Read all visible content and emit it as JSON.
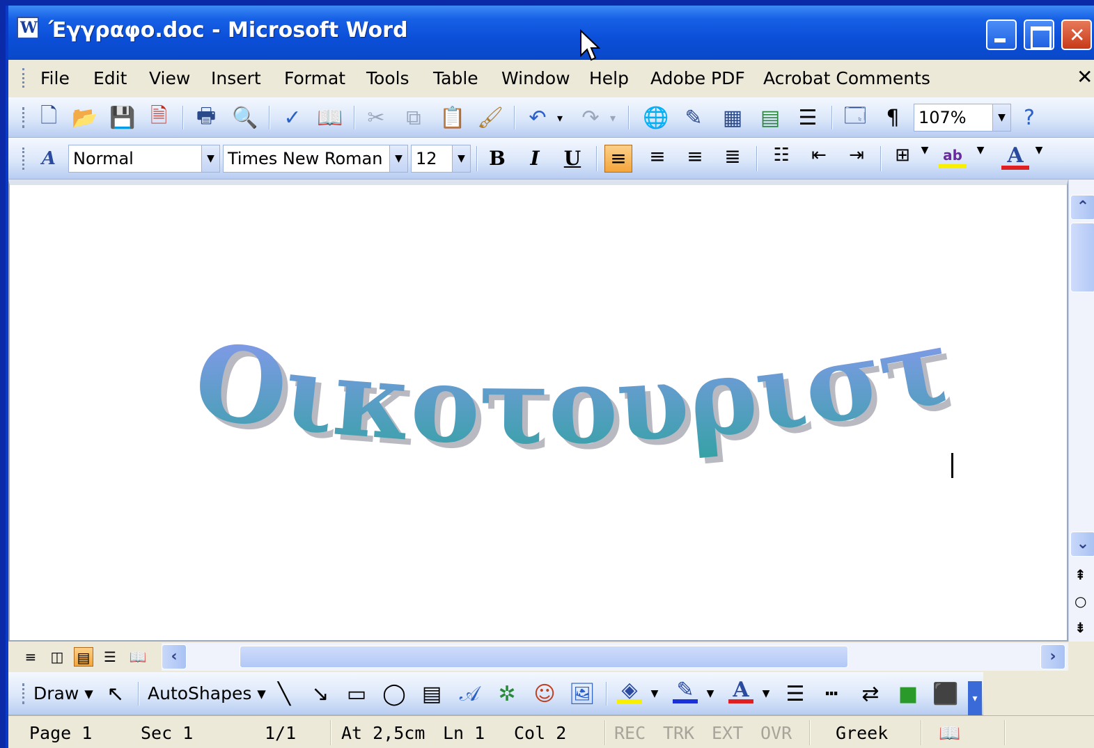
{
  "window": {
    "title": "Έγγραφο.doc - Microsoft Word"
  },
  "menu": [
    "File",
    "Edit",
    "View",
    "Insert",
    "Format",
    "Tools",
    "Table",
    "Window",
    "Help",
    "Adobe PDF",
    "Acrobat Comments"
  ],
  "standard_toolbar": {
    "zoom": "107%"
  },
  "formatting_toolbar": {
    "style": "Normal",
    "font": "Times New Roman",
    "size": "12"
  },
  "document": {
    "wordart_text": "Οικοτουριστική Α.Ε."
  },
  "drawing_toolbar": {
    "draw_label": "Draw",
    "autoshapes_label": "AutoShapes"
  },
  "status": {
    "page": "Page 1",
    "sec": "Sec 1",
    "pages": "1/1",
    "at": "At 2,5cm",
    "ln": "Ln 1",
    "col": "Col 2",
    "rec": "REC",
    "trk": "TRK",
    "ext": "EXT",
    "ovr": "OVR",
    "language": "Greek"
  },
  "colors": {
    "titlebar": "#0b4fd8",
    "wordart_top": "#a8b4f0",
    "wordart_bottom": "#3aa3a0"
  }
}
